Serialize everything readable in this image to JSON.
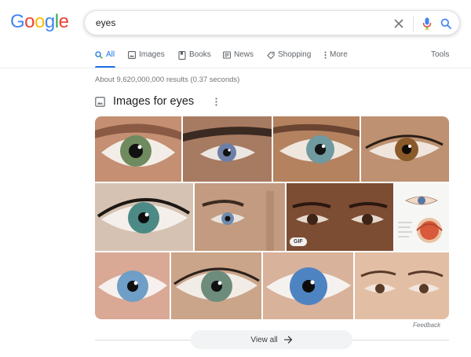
{
  "logo": {
    "text": "Google"
  },
  "search": {
    "query": "eyes"
  },
  "tabs": [
    {
      "label": "All",
      "icon": "search-icon",
      "active": true
    },
    {
      "label": "Images",
      "icon": "image-icon"
    },
    {
      "label": "Books",
      "icon": "book-icon"
    },
    {
      "label": "News",
      "icon": "newspaper-icon"
    },
    {
      "label": "Shopping",
      "icon": "tag-icon"
    },
    {
      "label": "More",
      "icon": "kebab-icon"
    }
  ],
  "tools_label": "Tools",
  "result_stats": "About 9,620,000,000 results (0.37 seconds)",
  "images_section": {
    "title": "Images for eyes",
    "gif_badge": "GIF",
    "feedback": "Feedback",
    "view_all": "View all"
  },
  "colors": {
    "accent": "#1a73e8",
    "logo_blue": "#4285f4",
    "logo_red": "#ea4335",
    "logo_yellow": "#fbbc05",
    "logo_green": "#34a853"
  }
}
